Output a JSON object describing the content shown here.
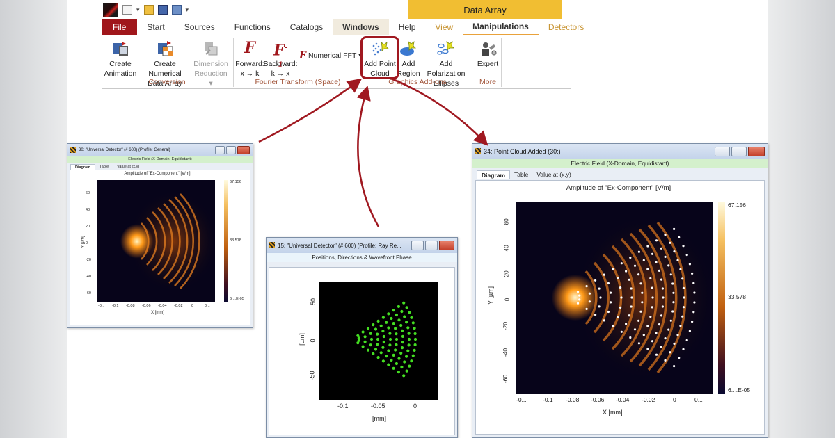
{
  "ribbon": {
    "context_tab": "Data Array",
    "tabs": [
      "File",
      "Start",
      "Sources",
      "Functions",
      "Catalogs",
      "Windows",
      "Help",
      "View",
      "Manipulations",
      "Detectors"
    ],
    "buttons": {
      "create_animation": [
        "Create",
        "Animation"
      ],
      "create_numerical_data_array": [
        "Create Numerical",
        "Data Array"
      ],
      "dimension_reduction": [
        "Dimension",
        "Reduction ▾"
      ],
      "forward": [
        "Forward:",
        "x → k"
      ],
      "backward": [
        "Backward:",
        "k → x"
      ],
      "numerical_fft": "Numerical FFT ▾",
      "add_point_cloud": [
        "Add Point",
        "Cloud"
      ],
      "add_region": [
        "Add",
        "Region"
      ],
      "add_polarization_ellipses": [
        "Add Polarization",
        "Ellipses"
      ],
      "expert": "Expert"
    },
    "groups": {
      "conversion": "Conversion",
      "fourier": "Fourier Transform (Space)",
      "graphics": "Graphics Add-ons",
      "more": "More"
    }
  },
  "windows": {
    "left": {
      "title": "30: \"Universal Detector\" (# 600) (Profile: General)",
      "subtitle": "Electric Field (X-Domain, Equidistant)",
      "tabs": [
        "Diagram",
        "Table",
        "Value at (x,y)"
      ],
      "plot_title": "Amplitude of \"Ex-Component\"  [V/m]",
      "ylabel": "Y [µm]",
      "xlabel": "X [mm]",
      "yticks": [
        "60",
        "40",
        "20",
        "0",
        "-20",
        "-40",
        "-60"
      ],
      "xticks": [
        "-0...",
        "-0.1",
        "-0.08",
        "-0.06",
        "-0.04",
        "-0.02",
        "0",
        "0..."
      ],
      "cbar": [
        "67.156",
        "33.578",
        "6....E-05"
      ]
    },
    "middle": {
      "title": "15: \"Universal Detector\" (# 600) (Profile: Ray Re...",
      "subtitle": "Positions, Directions & Wavefront Phase",
      "ylabel": "[µm]",
      "xlabel": "[mm]",
      "yticks": [
        "50",
        "0",
        "-50"
      ],
      "xticks": [
        "-0.1",
        "-0.05",
        "0"
      ]
    },
    "right": {
      "title": "34: Point Cloud Added (30:)",
      "subtitle": "Electric Field (X-Domain, Equidistant)",
      "tabs": [
        "Diagram",
        "Table",
        "Value at (x,y)"
      ],
      "plot_title": "Amplitude of \"Ex-Component\"  [V/m]",
      "ylabel": "Y [µm]",
      "xlabel": "X [mm]",
      "yticks": [
        "60",
        "40",
        "20",
        "0",
        "-20",
        "-40",
        "-60"
      ],
      "xticks": [
        "-0...",
        "-0.1",
        "-0.08",
        "-0.06",
        "-0.04",
        "-0.02",
        "0",
        "0..."
      ],
      "cbar": [
        "67.156",
        "33.578",
        "6....E-05"
      ]
    }
  },
  "colors": {
    "accent_red": "#a0161b",
    "context_yellow": "#f1be32",
    "arrow": "#a01820",
    "point_cloud_green": "#44dd22"
  }
}
